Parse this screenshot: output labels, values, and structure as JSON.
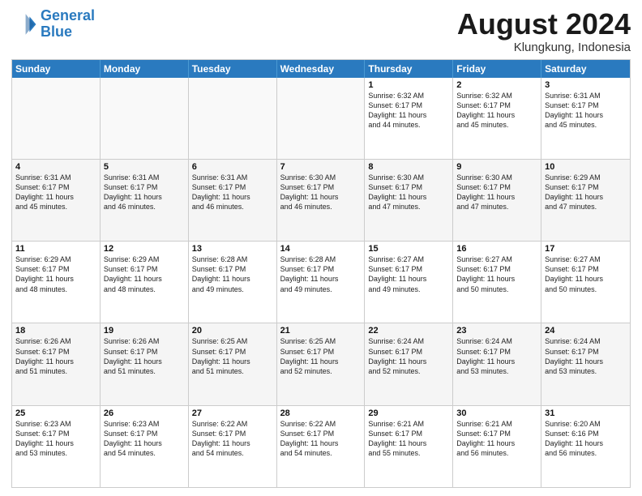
{
  "header": {
    "logo_line1": "General",
    "logo_line2": "Blue",
    "month": "August 2024",
    "location": "Klungkung, Indonesia"
  },
  "weekdays": [
    "Sunday",
    "Monday",
    "Tuesday",
    "Wednesday",
    "Thursday",
    "Friday",
    "Saturday"
  ],
  "rows": [
    [
      {
        "day": "",
        "info": ""
      },
      {
        "day": "",
        "info": ""
      },
      {
        "day": "",
        "info": ""
      },
      {
        "day": "",
        "info": ""
      },
      {
        "day": "1",
        "info": "Sunrise: 6:32 AM\nSunset: 6:17 PM\nDaylight: 11 hours\nand 44 minutes."
      },
      {
        "day": "2",
        "info": "Sunrise: 6:32 AM\nSunset: 6:17 PM\nDaylight: 11 hours\nand 45 minutes."
      },
      {
        "day": "3",
        "info": "Sunrise: 6:31 AM\nSunset: 6:17 PM\nDaylight: 11 hours\nand 45 minutes."
      }
    ],
    [
      {
        "day": "4",
        "info": "Sunrise: 6:31 AM\nSunset: 6:17 PM\nDaylight: 11 hours\nand 45 minutes."
      },
      {
        "day": "5",
        "info": "Sunrise: 6:31 AM\nSunset: 6:17 PM\nDaylight: 11 hours\nand 46 minutes."
      },
      {
        "day": "6",
        "info": "Sunrise: 6:31 AM\nSunset: 6:17 PM\nDaylight: 11 hours\nand 46 minutes."
      },
      {
        "day": "7",
        "info": "Sunrise: 6:30 AM\nSunset: 6:17 PM\nDaylight: 11 hours\nand 46 minutes."
      },
      {
        "day": "8",
        "info": "Sunrise: 6:30 AM\nSunset: 6:17 PM\nDaylight: 11 hours\nand 47 minutes."
      },
      {
        "day": "9",
        "info": "Sunrise: 6:30 AM\nSunset: 6:17 PM\nDaylight: 11 hours\nand 47 minutes."
      },
      {
        "day": "10",
        "info": "Sunrise: 6:29 AM\nSunset: 6:17 PM\nDaylight: 11 hours\nand 47 minutes."
      }
    ],
    [
      {
        "day": "11",
        "info": "Sunrise: 6:29 AM\nSunset: 6:17 PM\nDaylight: 11 hours\nand 48 minutes."
      },
      {
        "day": "12",
        "info": "Sunrise: 6:29 AM\nSunset: 6:17 PM\nDaylight: 11 hours\nand 48 minutes."
      },
      {
        "day": "13",
        "info": "Sunrise: 6:28 AM\nSunset: 6:17 PM\nDaylight: 11 hours\nand 49 minutes."
      },
      {
        "day": "14",
        "info": "Sunrise: 6:28 AM\nSunset: 6:17 PM\nDaylight: 11 hours\nand 49 minutes."
      },
      {
        "day": "15",
        "info": "Sunrise: 6:27 AM\nSunset: 6:17 PM\nDaylight: 11 hours\nand 49 minutes."
      },
      {
        "day": "16",
        "info": "Sunrise: 6:27 AM\nSunset: 6:17 PM\nDaylight: 11 hours\nand 50 minutes."
      },
      {
        "day": "17",
        "info": "Sunrise: 6:27 AM\nSunset: 6:17 PM\nDaylight: 11 hours\nand 50 minutes."
      }
    ],
    [
      {
        "day": "18",
        "info": "Sunrise: 6:26 AM\nSunset: 6:17 PM\nDaylight: 11 hours\nand 51 minutes."
      },
      {
        "day": "19",
        "info": "Sunrise: 6:26 AM\nSunset: 6:17 PM\nDaylight: 11 hours\nand 51 minutes."
      },
      {
        "day": "20",
        "info": "Sunrise: 6:25 AM\nSunset: 6:17 PM\nDaylight: 11 hours\nand 51 minutes."
      },
      {
        "day": "21",
        "info": "Sunrise: 6:25 AM\nSunset: 6:17 PM\nDaylight: 11 hours\nand 52 minutes."
      },
      {
        "day": "22",
        "info": "Sunrise: 6:24 AM\nSunset: 6:17 PM\nDaylight: 11 hours\nand 52 minutes."
      },
      {
        "day": "23",
        "info": "Sunrise: 6:24 AM\nSunset: 6:17 PM\nDaylight: 11 hours\nand 53 minutes."
      },
      {
        "day": "24",
        "info": "Sunrise: 6:24 AM\nSunset: 6:17 PM\nDaylight: 11 hours\nand 53 minutes."
      }
    ],
    [
      {
        "day": "25",
        "info": "Sunrise: 6:23 AM\nSunset: 6:17 PM\nDaylight: 11 hours\nand 53 minutes."
      },
      {
        "day": "26",
        "info": "Sunrise: 6:23 AM\nSunset: 6:17 PM\nDaylight: 11 hours\nand 54 minutes."
      },
      {
        "day": "27",
        "info": "Sunrise: 6:22 AM\nSunset: 6:17 PM\nDaylight: 11 hours\nand 54 minutes."
      },
      {
        "day": "28",
        "info": "Sunrise: 6:22 AM\nSunset: 6:17 PM\nDaylight: 11 hours\nand 54 minutes."
      },
      {
        "day": "29",
        "info": "Sunrise: 6:21 AM\nSunset: 6:17 PM\nDaylight: 11 hours\nand 55 minutes."
      },
      {
        "day": "30",
        "info": "Sunrise: 6:21 AM\nSunset: 6:17 PM\nDaylight: 11 hours\nand 56 minutes."
      },
      {
        "day": "31",
        "info": "Sunrise: 6:20 AM\nSunset: 6:16 PM\nDaylight: 11 hours\nand 56 minutes."
      }
    ]
  ]
}
